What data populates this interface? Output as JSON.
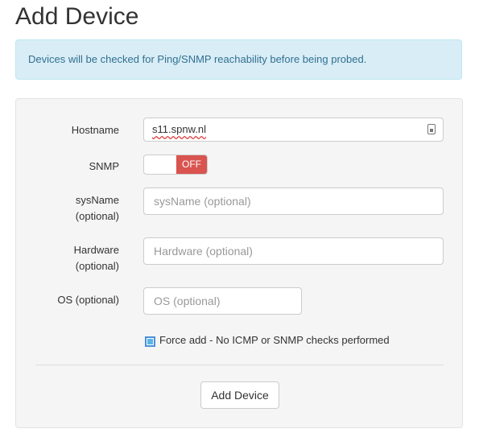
{
  "page": {
    "title": "Add Device"
  },
  "alert": {
    "text": "Devices will be checked for Ping/SNMP reachability before being probed."
  },
  "form": {
    "hostname": {
      "label": "Hostname",
      "value": "s11.spnw.nl"
    },
    "snmp": {
      "label": "SNMP",
      "state_label": "OFF",
      "off_color": "#d9534f"
    },
    "sysname": {
      "label_line1": "sysName",
      "label_line2": "(optional)",
      "placeholder": "sysName (optional)"
    },
    "hardware": {
      "label_line1": "Hardware",
      "label_line2": "(optional)",
      "placeholder": "Hardware (optional)"
    },
    "os": {
      "label": "OS (optional)",
      "placeholder": "OS (optional)"
    },
    "force_add": {
      "label": "Force add - No ICMP or SNMP checks performed",
      "checked": true
    },
    "submit_label": "Add Device"
  }
}
